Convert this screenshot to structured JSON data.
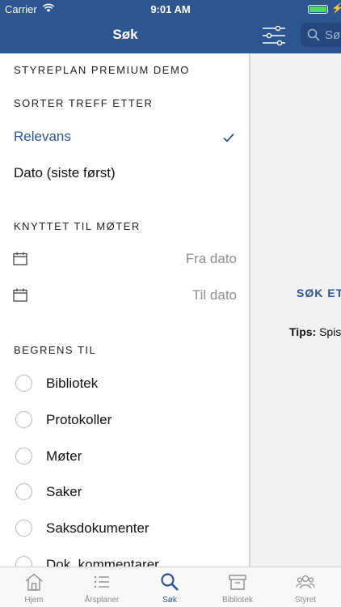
{
  "status_bar": {
    "carrier": "Carrier",
    "time": "9:01 AM"
  },
  "nav": {
    "title": "Søk",
    "search_placeholder": "Søk"
  },
  "panel": {
    "org_name": "STYREPLAN PREMIUM DEMO",
    "sort_header": "SORTER TREFF ETTER",
    "sort_options": [
      {
        "label": "Relevans",
        "selected": true
      },
      {
        "label": "Dato (siste først)",
        "selected": false
      }
    ],
    "meetings_header": "KNYTTET TIL MØTER",
    "from_date": "Fra dato",
    "to_date": "Til dato",
    "limit_header": "BEGRENS TIL",
    "limit_options": [
      "Bibliotek",
      "Protokoller",
      "Møter",
      "Saker",
      "Saksdokumenter",
      "Dok. kommentarer"
    ]
  },
  "right_pane": {
    "search_button": "SØK ETT",
    "tips_label": "Tips:",
    "tips_text": "Spis"
  },
  "tabs": [
    {
      "label": "Hjem",
      "icon": "home-icon",
      "active": false
    },
    {
      "label": "Årsplaner",
      "icon": "list-icon",
      "active": false
    },
    {
      "label": "Søk",
      "icon": "search-icon",
      "active": true
    },
    {
      "label": "Bibliotek",
      "icon": "archive-icon",
      "active": false
    },
    {
      "label": "Styret",
      "icon": "people-icon",
      "active": false
    }
  ],
  "colors": {
    "brand": "#2d5590",
    "battery": "#4cd964",
    "inactive": "#8e8e93"
  }
}
